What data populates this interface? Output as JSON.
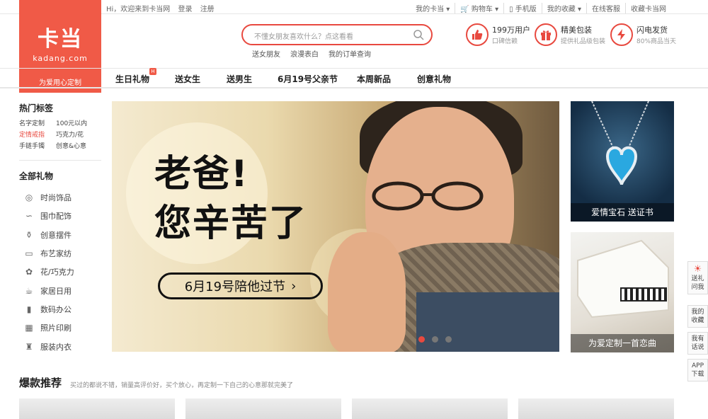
{
  "topbar": {
    "welcome": "Hi，欢迎来到卡当网",
    "login": "登录",
    "register": "注册",
    "links": [
      "我的卡当 ▾",
      "🛒 购物车 ▾",
      "▯ 手机版",
      "我的收藏 ▾",
      "在线客服",
      "收藏卡当网"
    ]
  },
  "logo": {
    "mark": "卡当",
    "domain": "kadang.com",
    "slogan": "为爱用心定制"
  },
  "search": {
    "placeholder": "不懂女朋友喜欢什么？点这看看",
    "hot": [
      "送女朋友",
      "浪漫表白",
      "我的订单查询"
    ]
  },
  "services": [
    {
      "title": "199万用户",
      "sub": "口碑信赖",
      "icon": "thumbs-up-icon"
    },
    {
      "title": "精美包装",
      "sub": "提供礼品级包装",
      "icon": "gift-icon"
    },
    {
      "title": "闪电发货",
      "sub": "80%商品当天",
      "icon": "lightning-icon"
    }
  ],
  "nav": {
    "items": [
      "生日礼物",
      "送女生",
      "送男生",
      "6月19号父亲节",
      "本周新品",
      "创意礼物"
    ],
    "badge": "H"
  },
  "sidebar": {
    "hot_tags_title": "热门标签",
    "tags": [
      [
        "名字定制",
        "100元以内"
      ],
      [
        "定情戒指",
        "巧克力/花"
      ],
      [
        "手链手镯",
        "创意&心意"
      ]
    ],
    "all_title": "全部礼物",
    "categories": [
      {
        "label": "时尚饰品",
        "icon": "ring-icon"
      },
      {
        "label": "围巾配饰",
        "icon": "scarf-icon"
      },
      {
        "label": "创意摆件",
        "icon": "vase-icon"
      },
      {
        "label": "布艺家纺",
        "icon": "pillow-icon"
      },
      {
        "label": "花/巧克力",
        "icon": "flower-icon"
      },
      {
        "label": "家居日用",
        "icon": "cup-icon"
      },
      {
        "label": "数码办公",
        "icon": "usb-icon"
      },
      {
        "label": "照片印刷",
        "icon": "calendar-icon"
      },
      {
        "label": "服装内衣",
        "icon": "clothes-icon"
      }
    ]
  },
  "hero": {
    "line1": "老爸!",
    "line2": "您辛苦了",
    "cta": "6月19号陪他过节",
    "cta_arrow": "›"
  },
  "promos": [
    {
      "caption": "爱情宝石 送证书"
    },
    {
      "caption": "为爱定制一首恋曲"
    }
  ],
  "float": [
    {
      "label": "送礼问我",
      "icon": "bulb-icon"
    },
    {
      "label": "我的收藏"
    },
    {
      "label": "我有话说"
    },
    {
      "label": "APP下载"
    }
  ],
  "section": {
    "title": "爆款推荐",
    "subtitle": "买过的都说不错，销量高评价好，买个放心，再定制一下自己的心意那就完美了"
  }
}
